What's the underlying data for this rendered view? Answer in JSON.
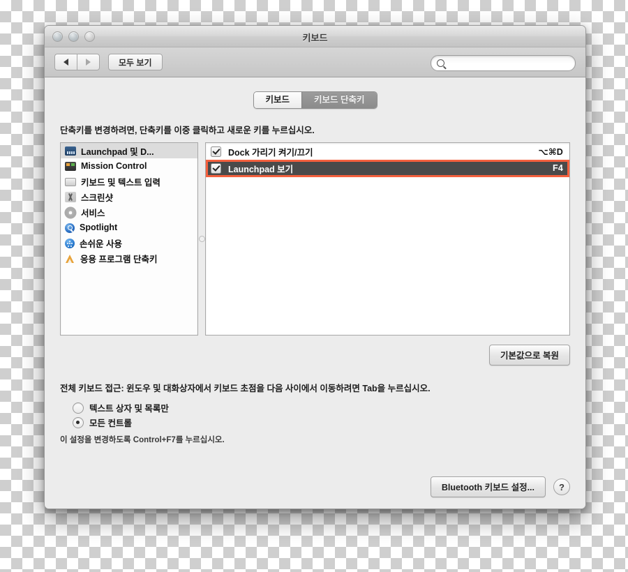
{
  "window": {
    "title": "키보드",
    "traffic_lights": [
      "close",
      "minimize",
      "zoom"
    ]
  },
  "toolbar": {
    "back_label": "◀",
    "forward_label": "▶",
    "show_all_label": "모두 보기",
    "search_placeholder": "",
    "search_value": ""
  },
  "tabs": [
    {
      "label": "키보드",
      "active": true
    },
    {
      "label": "키보드 단축키",
      "active": false
    }
  ],
  "hint_text": "단축키를 변경하려면, 단축키를 이중 클릭하고 새로운 키를 누르십시오.",
  "sidebar": {
    "items": [
      {
        "label": "Launchpad 및 D...",
        "icon": "dock-icon",
        "selected": true
      },
      {
        "label": "Mission Control",
        "icon": "mission-control-icon",
        "selected": false
      },
      {
        "label": "키보드 및 텍스트 입력",
        "icon": "keyboard-icon",
        "selected": false
      },
      {
        "label": "스크린샷",
        "icon": "scissors-icon",
        "selected": false
      },
      {
        "label": "서비스",
        "icon": "gear-icon",
        "selected": false
      },
      {
        "label": "Spotlight",
        "icon": "spotlight-icon",
        "selected": false
      },
      {
        "label": "손쉬운 사용",
        "icon": "accessibility-icon",
        "selected": false
      },
      {
        "label": "응용 프로그램 단축키",
        "icon": "application-icon",
        "selected": false
      }
    ]
  },
  "shortcuts": {
    "rows": [
      {
        "checked": true,
        "name": "Dock 가리기 켜기/끄기",
        "key": "⌥⌘D",
        "selected": false,
        "highlighted": false
      },
      {
        "checked": true,
        "name": "Launchpad 보기",
        "key": "F4",
        "selected": true,
        "highlighted": true
      }
    ],
    "highlight_color": "#f4603e"
  },
  "restore_button_label": "기본값으로 복원",
  "access": {
    "description": "전체 키보드 접근: 윈도우 및 대화상자에서 키보드 초점을 다음 사이에서 이동하려면 Tab을 누르십시오.",
    "options": [
      {
        "label": "텍스트 상자 및 목록만",
        "selected": false
      },
      {
        "label": "모든 컨트롤",
        "selected": true
      }
    ],
    "note": "이 설정을 변경하도록 Control+F7를 누르십시오."
  },
  "footer": {
    "bluetooth_button_label": "Bluetooth 키보드 설정...",
    "help_label": "?"
  }
}
